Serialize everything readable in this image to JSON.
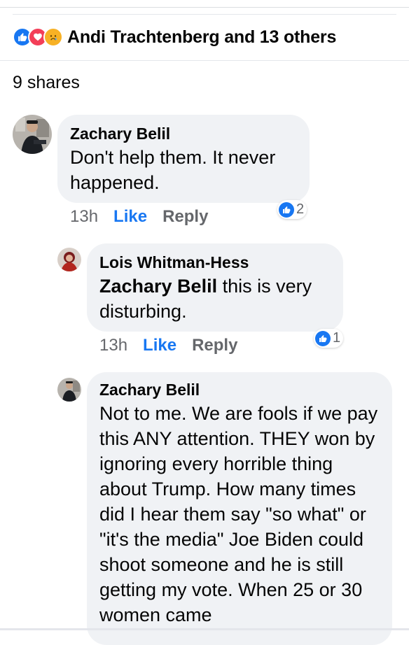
{
  "reactions": {
    "summary": "Andi Trachtenberg and 13 others",
    "icons": [
      "like-icon",
      "love-icon",
      "sad-icon"
    ],
    "colors": {
      "like": "#1877f2",
      "love": "#f33e58",
      "sad": "#f7b125"
    }
  },
  "shares": "9 shares",
  "comments": [
    {
      "author": "Zachary Belil",
      "text": "Don't help them. It never happened.",
      "time": "13h",
      "like_label": "Like",
      "reply_label": "Reply",
      "reaction_count": "2"
    },
    {
      "author": "Lois Whitman-Hess",
      "mention": "Zachary Belil",
      "text": " this is very disturbing.",
      "time": "13h",
      "like_label": "Like",
      "reply_label": "Reply",
      "reaction_count": "1"
    },
    {
      "author": "Zachary Belil",
      "text": "Not to me. We are fools if we pay this ANY attention. THEY won by ignoring every horrible thing about Trump. How many times did I hear them say \"so what\" or \"it's the media\" Joe Biden could shoot someone and he is still getting my vote. When 25 or 30 women came"
    }
  ]
}
